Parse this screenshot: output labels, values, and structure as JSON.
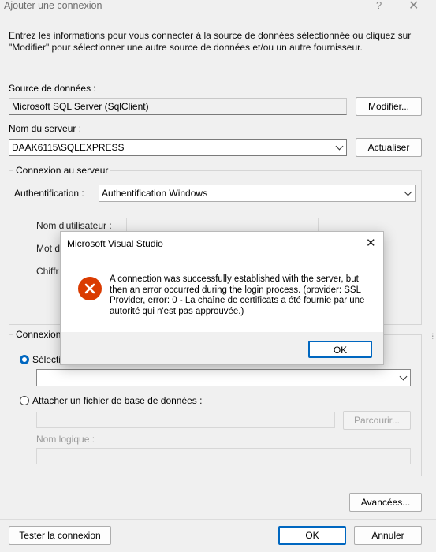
{
  "window": {
    "title": "Ajouter une connexion",
    "help_label": "?",
    "close_label": "✕"
  },
  "intro_text": "Entrez les informations pour vous connecter à la source de données sélectionnée ou cliquez sur \"Modifier\" pour sélectionner une autre source de données et/ou un autre fournisseur.",
  "datasource": {
    "label": "Source de données :",
    "value": "Microsoft SQL Server (SqlClient)",
    "modify_button": "Modifier..."
  },
  "server": {
    "label": "Nom du serveur :",
    "value": "DAAK6115\\SQLEXPRESS",
    "refresh_button": "Actualiser"
  },
  "server_connection": {
    "group_label": "Connexion au serveur",
    "auth_label": "Authentification :",
    "auth_value": "Authentification Windows",
    "username_label": "Nom d'utilisateur :",
    "password_label": "Mot d",
    "encrypt_label": "Chiffr"
  },
  "database_connection": {
    "group_label": "Connexion",
    "select_label": "Sélecti",
    "attach_label": "Attacher un fichier de base de données :",
    "browse_button": "Parcourir...",
    "logical_name_label": "Nom logique :"
  },
  "buttons": {
    "advanced": "Avancées...",
    "test": "Tester la connexion",
    "ok": "OK",
    "cancel": "Annuler"
  },
  "dialog": {
    "title": "Microsoft Visual Studio",
    "close_label": "✕",
    "message": "A connection was successfully established with the server, but then an error occurred during the login process. (provider: SSL Provider, error: 0 - La chaîne de certificats a été fournie par une autorité qui n'est pas approuvée.)",
    "ok_button": "OK",
    "icon": "error-icon",
    "icon_color": "#da3b01"
  },
  "colors": {
    "accent": "#0067c0",
    "error": "#da3b01"
  }
}
